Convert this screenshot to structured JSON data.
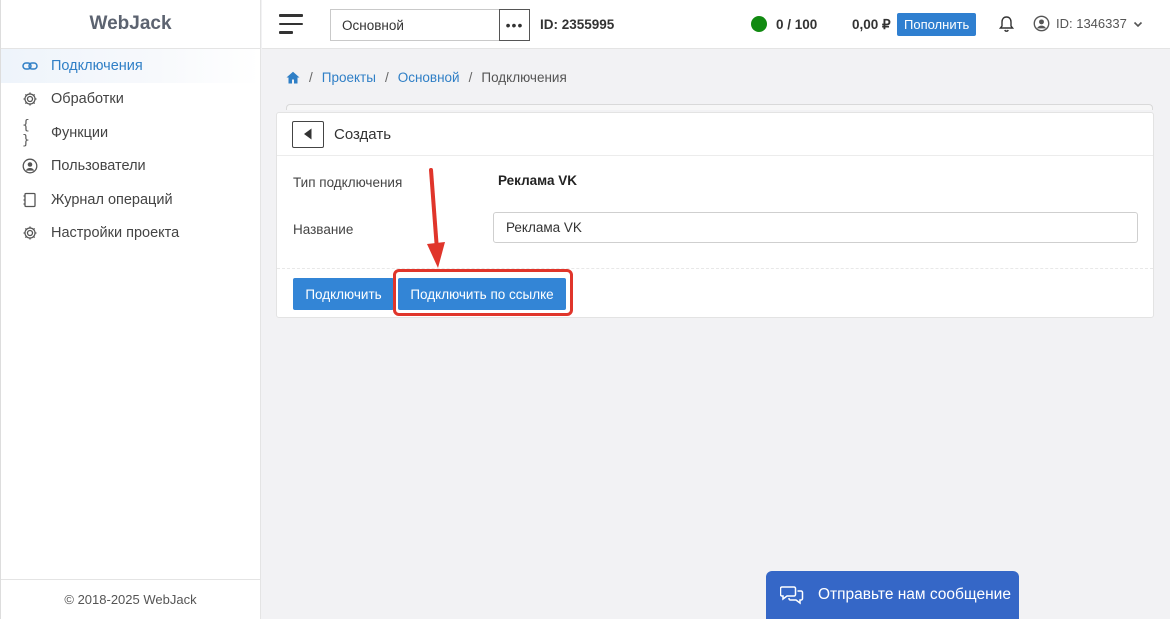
{
  "app": {
    "logo": "WebJack",
    "footer": "© 2018-2025 WebJack"
  },
  "sidebar": {
    "items": [
      {
        "label": "Подключения",
        "icon": "link-icon",
        "active": true
      },
      {
        "label": "Обработки",
        "icon": "gear-icon"
      },
      {
        "label": "Функции",
        "icon": "braces-icon"
      },
      {
        "label": "Пользователи",
        "icon": "user-circle-icon"
      },
      {
        "label": "Журнал операций",
        "icon": "notebook-icon"
      },
      {
        "label": "Настройки проекта",
        "icon": "gear-icon"
      }
    ]
  },
  "topbar": {
    "project": "Основной",
    "project_id": "ID: 2355995",
    "status_color": "#118a11",
    "limit": "0 / 100",
    "balance": "0,00 ₽",
    "topup_label": "Пополнить",
    "user_id": "ID: 1346337"
  },
  "breadcrumb": {
    "items": [
      "Проекты",
      "Основной",
      "Подключения"
    ]
  },
  "form": {
    "title": "Создать",
    "type_label": "Тип подключения",
    "type_value": "Реклама VK",
    "name_label": "Название",
    "name_value": "Реклама VK",
    "connect_label": "Подключить",
    "connect_link_label": "Подключить по ссылке"
  },
  "chat": {
    "label": "Отправьте нам сообщение"
  },
  "colors": {
    "accent": "#3385d6",
    "highlight": "#e0352b",
    "chat": "#3567c7"
  }
}
